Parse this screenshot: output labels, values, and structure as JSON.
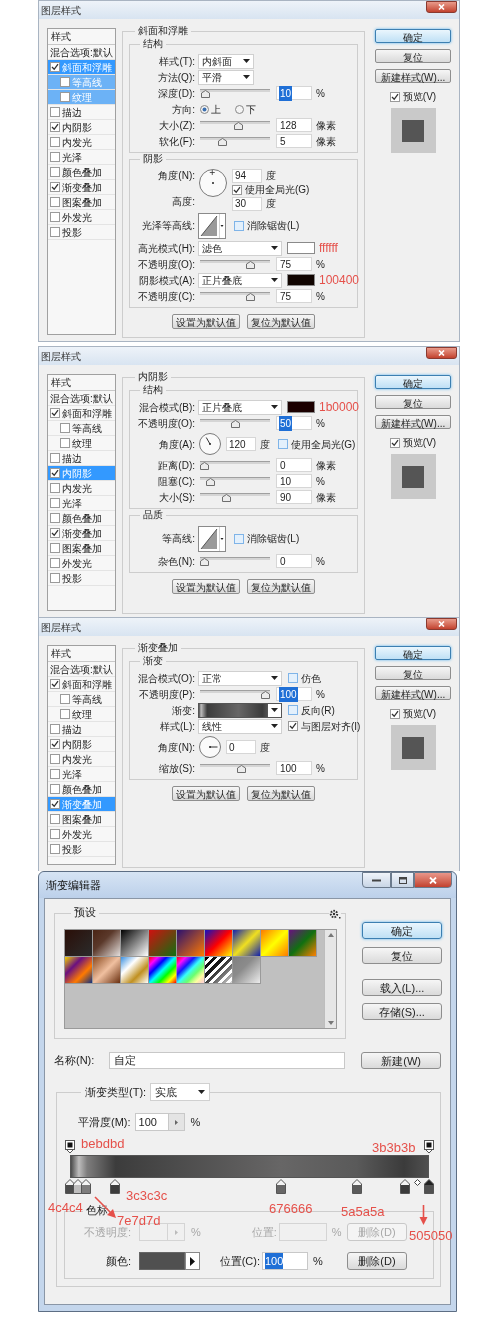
{
  "dialogs": [
    {
      "kind": "layer_style",
      "title": "图层样式",
      "styles": [
        {
          "kind": "header",
          "label": "样式"
        },
        {
          "kind": "option",
          "label": "混合选项:默认",
          "selected": false
        },
        {
          "kind": "style",
          "label": "斜面和浮雕",
          "checked": true,
          "selected": true,
          "children": [
            {
              "kind": "style",
              "label": "等高线",
              "checked": false,
              "selected": true
            },
            {
              "kind": "style",
              "label": "纹理",
              "checked": false,
              "selected": true
            }
          ]
        },
        {
          "kind": "style",
          "label": "描边",
          "checked": false,
          "selected": false
        },
        {
          "kind": "style",
          "label": "内阴影",
          "checked": true,
          "selected": false
        },
        {
          "kind": "style",
          "label": "内发光",
          "checked": false,
          "selected": false
        },
        {
          "kind": "style",
          "label": "光泽",
          "checked": false,
          "selected": false
        },
        {
          "kind": "style",
          "label": "颜色叠加",
          "checked": false,
          "selected": false
        },
        {
          "kind": "style",
          "label": "渐变叠加",
          "checked": true,
          "selected": false
        },
        {
          "kind": "style",
          "label": "图案叠加",
          "checked": false,
          "selected": false
        },
        {
          "kind": "style",
          "label": "外发光",
          "checked": false,
          "selected": false
        },
        {
          "kind": "style",
          "label": "投影",
          "checked": false,
          "selected": false
        }
      ],
      "section": "斜面和浮雕",
      "groups": [
        {
          "title": "结构",
          "rows": [
            {
              "kind": "select",
              "label": "样式(T):",
              "value": "内斜面"
            },
            {
              "kind": "select",
              "label": "方法(Q):",
              "value": "平滑"
            },
            {
              "kind": "slider",
              "label": "深度(D):",
              "level": 0.02,
              "value": "10",
              "value_selected": true,
              "unit": "%"
            },
            {
              "kind": "radio",
              "label": "方向:",
              "options": [
                {
                  "label": "上",
                  "selected": true
                },
                {
                  "label": "下",
                  "selected": false
                }
              ]
            },
            {
              "kind": "slider",
              "label": "大小(Z):",
              "level": 0.55,
              "value": "128",
              "value_selected": false,
              "unit": "像素"
            },
            {
              "kind": "slider",
              "label": "软化(F):",
              "level": 0.3,
              "value": "5",
              "value_selected": false,
              "unit": "像素"
            }
          ]
        },
        {
          "title": "阴影",
          "rows": [
            {
              "kind": "angle_altitude",
              "label": "角度(N):",
              "value": "94",
              "unit": "度",
              "checkbox": {
                "label": "使用全局光(G)",
                "checked": true
              },
              "altitude_label": "高度:",
              "altitude_value": "30",
              "altitude_unit": "度"
            },
            {
              "kind": "contour",
              "label": "光泽等高线:",
              "checkbox": {
                "label": "消除锯齿(L)",
                "checked": false
              }
            },
            {
              "kind": "select",
              "label": "高光模式(H):",
              "value": "滤色",
              "color": "#ffffff",
              "note": "ffffff"
            },
            {
              "kind": "slider",
              "label": "不透明度(O):",
              "level": 0.75,
              "value": "75",
              "value_selected": false,
              "unit": "%"
            },
            {
              "kind": "select",
              "label": "阴影模式(A):",
              "value": "正片叠底",
              "color": "#100400",
              "note": "100400"
            },
            {
              "kind": "slider",
              "label": "不透明度(C):",
              "level": 0.75,
              "value": "75",
              "value_selected": false,
              "unit": "%"
            }
          ]
        }
      ],
      "footer_buttons": [
        "设置为默认值",
        "复位为默认值"
      ],
      "buttons": [
        {
          "label": "确定",
          "default": true
        },
        {
          "label": "复位",
          "default": false
        },
        {
          "label": "新建样式(W)...",
          "default": false
        }
      ],
      "preview": {
        "label": "预览(V)",
        "checked": true
      }
    },
    {
      "kind": "layer_style",
      "title": "图层样式",
      "styles": [
        {
          "kind": "header",
          "label": "样式"
        },
        {
          "kind": "option",
          "label": "混合选项:默认",
          "selected": false
        },
        {
          "kind": "style",
          "label": "斜面和浮雕",
          "checked": true,
          "selected": false,
          "children": [
            {
              "kind": "style",
              "label": "等高线",
              "checked": false,
              "selected": false
            },
            {
              "kind": "style",
              "label": "纹理",
              "checked": false,
              "selected": false
            }
          ]
        },
        {
          "kind": "style",
          "label": "描边",
          "checked": false,
          "selected": false
        },
        {
          "kind": "style",
          "label": "内阴影",
          "checked": true,
          "selected": true
        },
        {
          "kind": "style",
          "label": "内发光",
          "checked": false,
          "selected": false
        },
        {
          "kind": "style",
          "label": "光泽",
          "checked": false,
          "selected": false
        },
        {
          "kind": "style",
          "label": "颜色叠加",
          "checked": false,
          "selected": false
        },
        {
          "kind": "style",
          "label": "渐变叠加",
          "checked": true,
          "selected": false
        },
        {
          "kind": "style",
          "label": "图案叠加",
          "checked": false,
          "selected": false
        },
        {
          "kind": "style",
          "label": "外发光",
          "checked": false,
          "selected": false
        },
        {
          "kind": "style",
          "label": "投影",
          "checked": false,
          "selected": false
        }
      ],
      "section": "内阴影",
      "groups": [
        {
          "title": "结构",
          "rows": [
            {
              "kind": "select",
              "label": "混合模式(B):",
              "value": "正片叠底",
              "color": "#1b0000",
              "note": "1b0000"
            },
            {
              "kind": "slider",
              "label": "不透明度(O):",
              "level": 0.5,
              "value": "50",
              "value_selected": true,
              "unit": "%"
            },
            {
              "kind": "angle",
              "label": "角度(A):",
              "value": "120",
              "unit": "度",
              "checkbox": {
                "label": "使用全局光(G)",
                "checked": false
              }
            },
            {
              "kind": "slider",
              "label": "距离(D):",
              "level": 0,
              "value": "0",
              "value_selected": false,
              "unit": "像素"
            },
            {
              "kind": "slider",
              "label": "阻塞(C):",
              "level": 0.1,
              "value": "10",
              "value_selected": false,
              "unit": "%"
            },
            {
              "kind": "slider",
              "label": "大小(S):",
              "level": 0.36,
              "value": "90",
              "value_selected": false,
              "unit": "像素"
            }
          ]
        },
        {
          "title": "品质",
          "rows": [
            {
              "kind": "contour",
              "label": "等高线:",
              "checkbox": {
                "label": "消除锯齿(L)",
                "checked": false
              }
            },
            {
              "kind": "slider",
              "label": "杂色(N):",
              "level": 0,
              "value": "0",
              "value_selected": false,
              "unit": "%"
            }
          ]
        }
      ],
      "footer_buttons": [
        "设置为默认值",
        "复位为默认值"
      ],
      "buttons": [
        {
          "label": "确定",
          "default": true
        },
        {
          "label": "复位",
          "default": false
        },
        {
          "label": "新建样式(W)...",
          "default": false
        }
      ],
      "preview": {
        "label": "预览(V)",
        "checked": true
      }
    },
    {
      "kind": "layer_style",
      "title": "图层样式",
      "styles": [
        {
          "kind": "header",
          "label": "样式"
        },
        {
          "kind": "option",
          "label": "混合选项:默认",
          "selected": false
        },
        {
          "kind": "style",
          "label": "斜面和浮雕",
          "checked": true,
          "selected": false,
          "children": [
            {
              "kind": "style",
              "label": "等高线",
              "checked": false,
              "selected": false
            },
            {
              "kind": "style",
              "label": "纹理",
              "checked": false,
              "selected": false
            }
          ]
        },
        {
          "kind": "style",
          "label": "描边",
          "checked": false,
          "selected": false
        },
        {
          "kind": "style",
          "label": "内阴影",
          "checked": true,
          "selected": false
        },
        {
          "kind": "style",
          "label": "内发光",
          "checked": false,
          "selected": false
        },
        {
          "kind": "style",
          "label": "光泽",
          "checked": false,
          "selected": false
        },
        {
          "kind": "style",
          "label": "颜色叠加",
          "checked": false,
          "selected": false
        },
        {
          "kind": "style",
          "label": "渐变叠加",
          "checked": true,
          "selected": true
        },
        {
          "kind": "style",
          "label": "图案叠加",
          "checked": false,
          "selected": false
        },
        {
          "kind": "style",
          "label": "外发光",
          "checked": false,
          "selected": false
        },
        {
          "kind": "style",
          "label": "投影",
          "checked": false,
          "selected": false
        }
      ],
      "section": "渐变叠加",
      "groups": [
        {
          "title": "渐变",
          "rows": [
            {
              "kind": "select",
              "label": "混合模式(O):",
              "value": "正常",
              "checkbox": {
                "label": "仿色",
                "checked": false
              }
            },
            {
              "kind": "slider",
              "label": "不透明度(P):",
              "level": 1,
              "value": "100",
              "value_selected": true,
              "unit": "%"
            },
            {
              "kind": "gradient",
              "label": "渐变:",
              "checkbox": {
                "label": "反向(R)",
                "checked": false
              }
            },
            {
              "kind": "select",
              "label": "样式(L):",
              "value": "线性",
              "checkbox": {
                "label": "与图层对齐(I)",
                "checked": true
              }
            },
            {
              "kind": "angle",
              "label": "角度(N):",
              "value": "0",
              "unit": "度"
            },
            {
              "kind": "slider",
              "label": "缩放(S):",
              "level": 0.6,
              "value": "100",
              "value_selected": false,
              "unit": "%"
            }
          ]
        }
      ],
      "footer_buttons": [
        "设置为默认值",
        "复位为默认值"
      ],
      "buttons": [
        {
          "label": "确定",
          "default": true
        },
        {
          "label": "复位",
          "default": false
        },
        {
          "label": "新建样式(W)...",
          "default": false
        }
      ],
      "preview": {
        "label": "预览(V)",
        "checked": true
      }
    },
    {
      "kind": "gradient_editor",
      "title": "渐变编辑器",
      "presets_title": "预设",
      "buttons": [
        {
          "label": "确定",
          "default": true
        },
        {
          "label": "复位",
          "default": false
        },
        {
          "label": "载入(L)...",
          "default": false
        },
        {
          "label": "存储(S)...",
          "default": false
        }
      ],
      "name_label": "名称(N):",
      "name_value": "自定",
      "new_button": "新建(W)",
      "type_label": "渐变类型(T):",
      "type_value": "实底",
      "smoothness_label": "平滑度(M):",
      "smoothness_value": "100",
      "smoothness_unit": "%",
      "opacity_stops": [
        {
          "level": 0,
          "selected": false
        },
        {
          "level": 1,
          "selected": false
        }
      ],
      "color_stops": [
        {
          "level": 0,
          "color": "#4c4c4c",
          "selected": false
        },
        {
          "level": 0.022,
          "color": "#bebdbd",
          "selected": false
        },
        {
          "level": 0.045,
          "color": "#7e7d7d",
          "selected": false
        },
        {
          "level": 0.125,
          "color": "#3c3c3c",
          "selected": false
        },
        {
          "level": 0.588,
          "color": "#676666",
          "selected": false
        },
        {
          "level": 0.8,
          "color": "#5a5a5a",
          "selected": false
        },
        {
          "level": 0.933,
          "color": "#3b3b3b",
          "selected": false
        },
        {
          "level": 1,
          "color": "#505050",
          "selected": true
        }
      ],
      "stops_title": "色标",
      "stop_rows": [
        {
          "kind": "opacity",
          "disabled": true,
          "label": "不透明度:",
          "unit": "%",
          "location_label": "位置:",
          "location_unit": "%",
          "delete": "删除(D)"
        },
        {
          "kind": "color",
          "disabled": false,
          "label": "颜色:",
          "color": "#505050",
          "location_label": "位置(C):",
          "location_value": "100",
          "value_selected": true,
          "location_unit": "%",
          "delete": "删除(D)"
        }
      ],
      "annotations": [
        "bebdbd",
        "3b3b3b",
        "3c3c3c",
        "4c4c4",
        "7e7d7d",
        "676666",
        "5a5a5a",
        "505050"
      ]
    }
  ]
}
